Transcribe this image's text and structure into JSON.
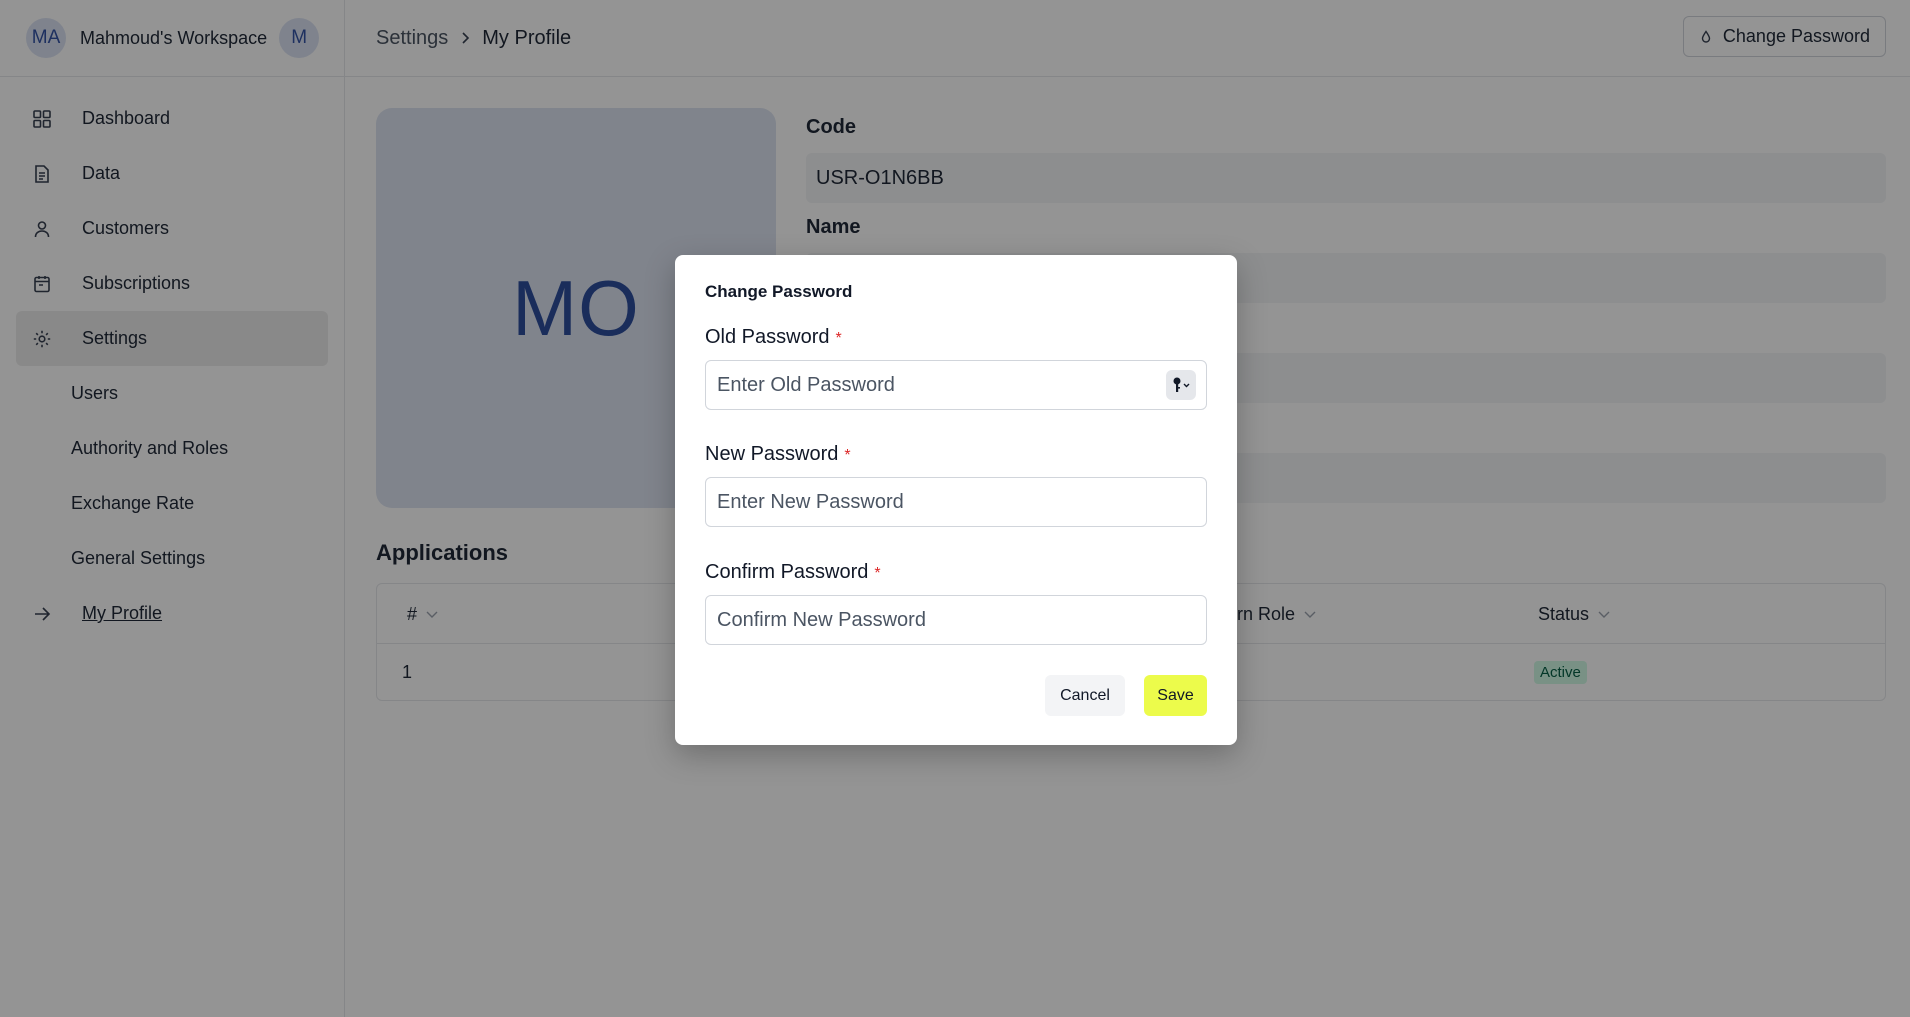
{
  "workspace": {
    "avatar": "MA",
    "name": "Mahmoud's Workspace",
    "user_avatar": "M"
  },
  "sidebar": {
    "items": [
      {
        "label": "Dashboard",
        "icon": "grid-icon"
      },
      {
        "label": "Data",
        "icon": "document-icon"
      },
      {
        "label": "Customers",
        "icon": "user-icon"
      },
      {
        "label": "Subscriptions",
        "icon": "calendar-icon"
      },
      {
        "label": "Settings",
        "icon": "gear-icon"
      }
    ],
    "settings_sub": [
      "Users",
      "Authority and Roles",
      "Exchange Rate",
      "General Settings"
    ],
    "my_profile": "My Profile"
  },
  "breadcrumb": {
    "parent": "Settings",
    "current": "My Profile"
  },
  "header": {
    "change_password_label": "Change Password"
  },
  "profile": {
    "initials": "MO",
    "code_label": "Code",
    "code_value": "USR-O1N6BB",
    "name_label": "Name"
  },
  "applications": {
    "title": "Applications",
    "columns": [
      "#",
      "ern Role",
      "Status"
    ],
    "rows": [
      {
        "index": "1",
        "status": "Active"
      }
    ]
  },
  "modal": {
    "title": "Change Password",
    "old_label": "Old Password",
    "old_placeholder": "Enter Old Password",
    "new_label": "New Password",
    "new_placeholder": "Enter New Password",
    "confirm_label": "Confirm Password",
    "confirm_placeholder": "Confirm New Password",
    "required_mark": "*",
    "cancel_label": "Cancel",
    "save_label": "Save"
  },
  "colors": {
    "accent_save": "#ecfb4b",
    "avatar_bg": "#dde3f1",
    "avatar_text": "#2d4e9e",
    "required": "#dc2626",
    "active_badge": "#d1fae5"
  }
}
